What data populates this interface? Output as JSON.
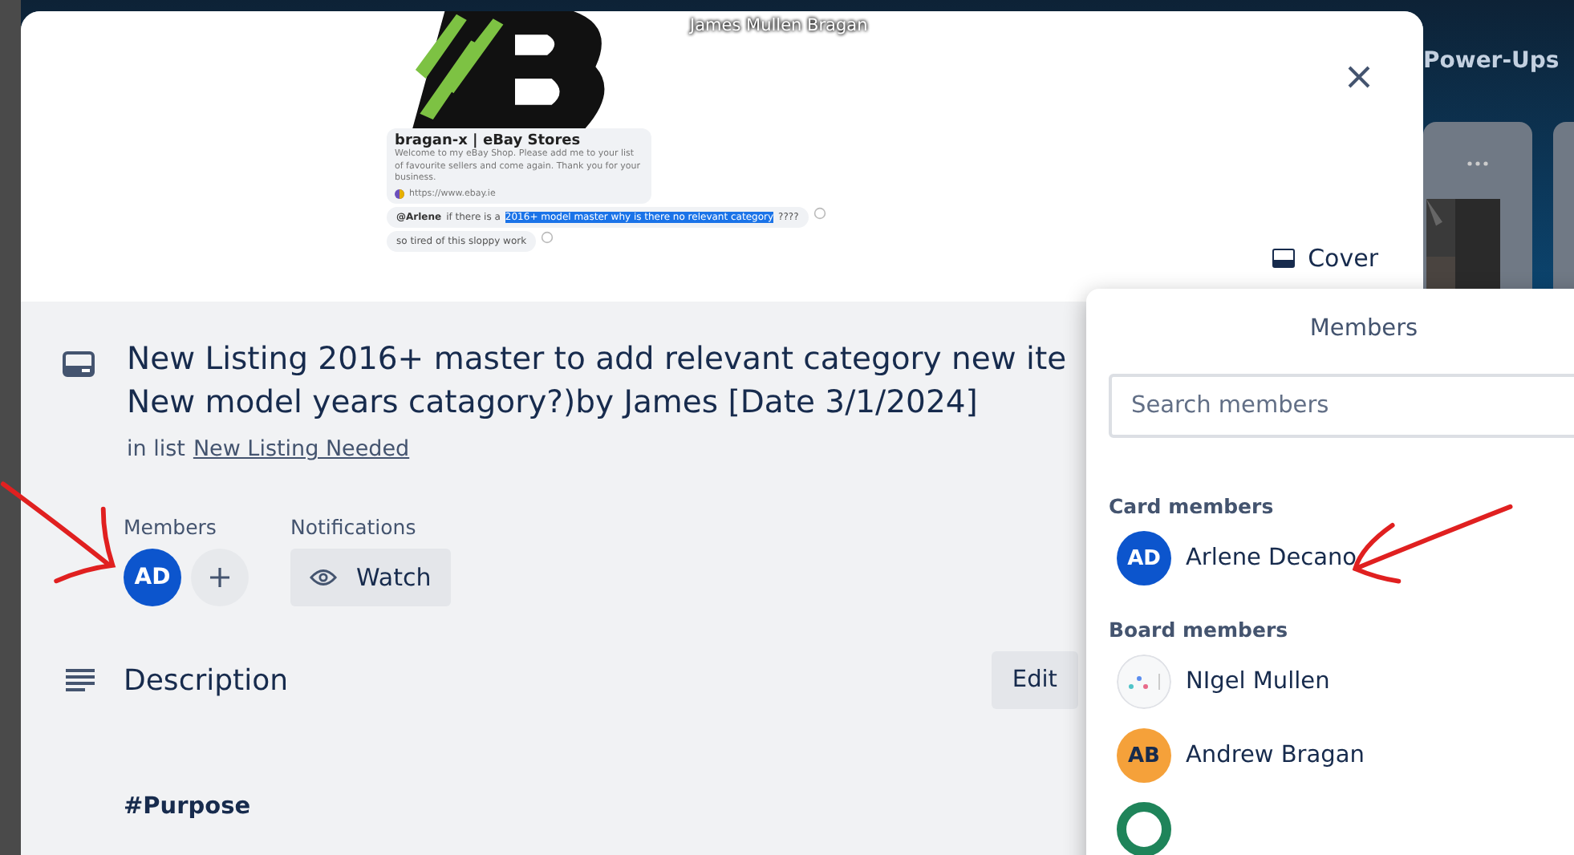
{
  "overlay_caption": "James Mullen Bragan",
  "board": {
    "header_button": "Power-Ups"
  },
  "cover": {
    "post_title": "bragan-x | eBay Stores",
    "post_text": "Welcome to my eBay Shop. Please add me to your list of favourite sellers and come again. Thank you for your business.",
    "post_link": "https://www.ebay.ie",
    "comments": [
      {
        "author": "@Arlene",
        "text": "if there is a",
        "highlight": "2016+ model master why is there no relevant category",
        "after": "????"
      },
      {
        "text": "so tired of this sloppy work"
      }
    ],
    "cover_button": "Cover"
  },
  "card": {
    "title_lines": [
      "New Listing 2016+ master to add relevant category new ite",
      "New model years catagory?)by James [Date 3/1/2024]"
    ],
    "list_prefix": "in list",
    "list_name": "New Listing Needed",
    "members_label": "Members",
    "members": [
      {
        "initials": "AD",
        "color": "#0c55cd"
      }
    ],
    "notifications_label": "Notifications",
    "watch_button": "Watch",
    "description_heading": "Description",
    "edit_button": "Edit",
    "description_text": "#Purpose"
  },
  "members_popup": {
    "title": "Members",
    "search_placeholder": "Search members",
    "sections": [
      {
        "heading": "Card members",
        "members": [
          {
            "kind": "initials",
            "initials": "AD",
            "name": "Arlene Decano",
            "color": "#0c55cd"
          }
        ]
      },
      {
        "heading": "Board members",
        "members": [
          {
            "name": "NIgel Mullen"
          },
          {
            "kind": "initials",
            "initials": "AB",
            "name": "Andrew Bragan",
            "color": "#f5a13a"
          },
          {
            "kind": "blank",
            "color": "#1f845a"
          }
        ]
      }
    ]
  }
}
